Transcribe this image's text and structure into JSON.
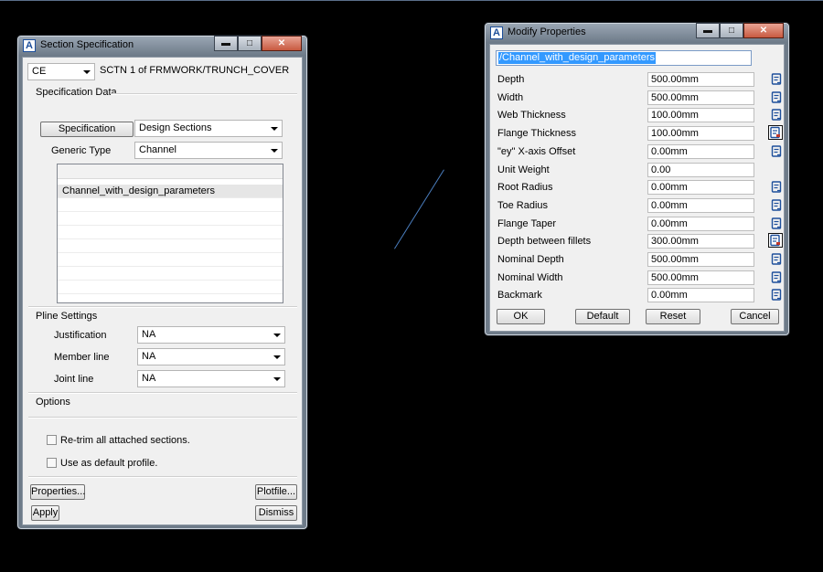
{
  "colors": {
    "desktop": "#000000",
    "selection": "#3399ff",
    "icon_blue": "#1d4f9b",
    "icon_red": "#c0392b"
  },
  "section_window": {
    "title": "Section Specification",
    "ce_combo": "CE",
    "ce_description": "SCTN 1 of FRMWORK/TRUNCH_COVER",
    "spec_group_label": "Specification Data",
    "specification_button": "Specification",
    "specification_combo": "Design Sections",
    "generic_type_label": "Generic Type",
    "generic_type_combo": "Channel",
    "list_items": [
      "Channel_with_design_parameters"
    ],
    "pline_group_label": "Pline Settings",
    "justification_label": "Justification",
    "justification_combo": "NA",
    "member_line_label": "Member line",
    "member_line_combo": "NA",
    "joint_line_label": "Joint line",
    "joint_line_combo": "NA",
    "options_label": "Options",
    "retrim_label": "Re-trim all attached sections.",
    "retrim_checked": false,
    "default_profile_label": "Use as default profile.",
    "default_profile_checked": false,
    "properties_button": "Properties...",
    "plotfile_button": "Plotfile...",
    "apply_button": "Apply",
    "dismiss_button": "Dismiss"
  },
  "modify_window": {
    "title": "Modify Properties",
    "name_field": "/Channel_with_design_parameters",
    "properties": [
      {
        "label": "Depth",
        "value": "500.00mm",
        "icon": "edit-icon"
      },
      {
        "label": "Width",
        "value": "500.00mm",
        "icon": "edit-icon"
      },
      {
        "label": "Web Thickness",
        "value": "100.00mm",
        "icon": "edit-icon"
      },
      {
        "label": "Flange Thickness",
        "value": "100.00mm",
        "icon": "edit-icon-highlighted"
      },
      {
        "label": "\"ey\" X-axis Offset",
        "value": "0.00mm",
        "icon": "edit-icon"
      },
      {
        "label": "Unit Weight",
        "value": "0.00",
        "icon": ""
      },
      {
        "label": "Root Radius",
        "value": "0.00mm",
        "icon": "edit-icon"
      },
      {
        "label": "Toe Radius",
        "value": "0.00mm",
        "icon": "edit-icon"
      },
      {
        "label": "Flange Taper",
        "value": "0.00mm",
        "icon": "edit-icon"
      },
      {
        "label": "Depth between fillets",
        "value": "300.00mm",
        "icon": "edit-icon-highlighted"
      },
      {
        "label": "Nominal Depth",
        "value": "500.00mm",
        "icon": "edit-icon"
      },
      {
        "label": "Nominal Width",
        "value": "500.00mm",
        "icon": "edit-icon"
      },
      {
        "label": "Backmark",
        "value": "0.00mm",
        "icon": "edit-icon"
      }
    ],
    "ok_button": "OK",
    "default_button": "Default",
    "reset_button": "Reset",
    "cancel_button": "Cancel"
  }
}
